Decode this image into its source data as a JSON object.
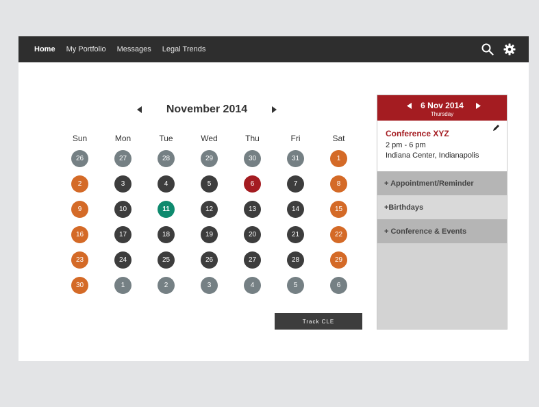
{
  "nav": {
    "items": [
      {
        "label": "Home",
        "active": true
      },
      {
        "label": "My Portfolio",
        "active": false
      },
      {
        "label": "Messages",
        "active": false
      },
      {
        "label": "Legal Trends",
        "active": false
      }
    ],
    "icons": [
      "search-icon",
      "gear-icon"
    ]
  },
  "calendar": {
    "month_title": "November 2014",
    "weekdays": [
      "Sun",
      "Mon",
      "Tue",
      "Wed",
      "Thu",
      "Fri",
      "Sat"
    ],
    "weeks": [
      [
        {
          "d": "26",
          "t": "other"
        },
        {
          "d": "27",
          "t": "other"
        },
        {
          "d": "28",
          "t": "other"
        },
        {
          "d": "29",
          "t": "other"
        },
        {
          "d": "30",
          "t": "other"
        },
        {
          "d": "31",
          "t": "other"
        },
        {
          "d": "1",
          "t": "weekend"
        }
      ],
      [
        {
          "d": "2",
          "t": "weekend"
        },
        {
          "d": "3",
          "t": "weekday"
        },
        {
          "d": "4",
          "t": "weekday"
        },
        {
          "d": "5",
          "t": "weekday"
        },
        {
          "d": "6",
          "t": "event"
        },
        {
          "d": "7",
          "t": "weekday"
        },
        {
          "d": "8",
          "t": "weekend"
        }
      ],
      [
        {
          "d": "9",
          "t": "weekend"
        },
        {
          "d": "10",
          "t": "weekday"
        },
        {
          "d": "11",
          "t": "today"
        },
        {
          "d": "12",
          "t": "weekday"
        },
        {
          "d": "13",
          "t": "weekday"
        },
        {
          "d": "14",
          "t": "weekday"
        },
        {
          "d": "15",
          "t": "weekend"
        }
      ],
      [
        {
          "d": "16",
          "t": "weekend"
        },
        {
          "d": "17",
          "t": "weekday"
        },
        {
          "d": "18",
          "t": "weekday"
        },
        {
          "d": "19",
          "t": "weekday"
        },
        {
          "d": "20",
          "t": "weekday"
        },
        {
          "d": "21",
          "t": "weekday"
        },
        {
          "d": "22",
          "t": "weekend"
        }
      ],
      [
        {
          "d": "23",
          "t": "weekend"
        },
        {
          "d": "24",
          "t": "weekday"
        },
        {
          "d": "25",
          "t": "weekday"
        },
        {
          "d": "26",
          "t": "weekday"
        },
        {
          "d": "27",
          "t": "weekday"
        },
        {
          "d": "28",
          "t": "weekday"
        },
        {
          "d": "29",
          "t": "weekend"
        }
      ],
      [
        {
          "d": "30",
          "t": "weekend"
        },
        {
          "d": "1",
          "t": "other"
        },
        {
          "d": "2",
          "t": "other"
        },
        {
          "d": "3",
          "t": "other"
        },
        {
          "d": "4",
          "t": "other"
        },
        {
          "d": "5",
          "t": "other"
        },
        {
          "d": "6",
          "t": "other"
        }
      ]
    ],
    "track_label": "Track CLE"
  },
  "panel": {
    "date": "6 Nov 2014",
    "weekday": "Thursday",
    "event": {
      "title": "Conference XYZ",
      "time": "2 pm - 6 pm",
      "place": "Indiana Center, Indianapolis"
    },
    "sections": [
      {
        "label": "+ Appointment/Reminder",
        "style": "dark"
      },
      {
        "label": "+Birthdays",
        "style": "light"
      },
      {
        "label": "+ Conference & Events",
        "style": "dark"
      }
    ]
  },
  "colors": {
    "navbar": "#2e2e2e",
    "accent_red": "#a41c21",
    "weekend_orange": "#d46a27",
    "today_green": "#0e8a6e",
    "other_month_gray": "#758084",
    "weekday_dark": "#3d3d3d"
  }
}
